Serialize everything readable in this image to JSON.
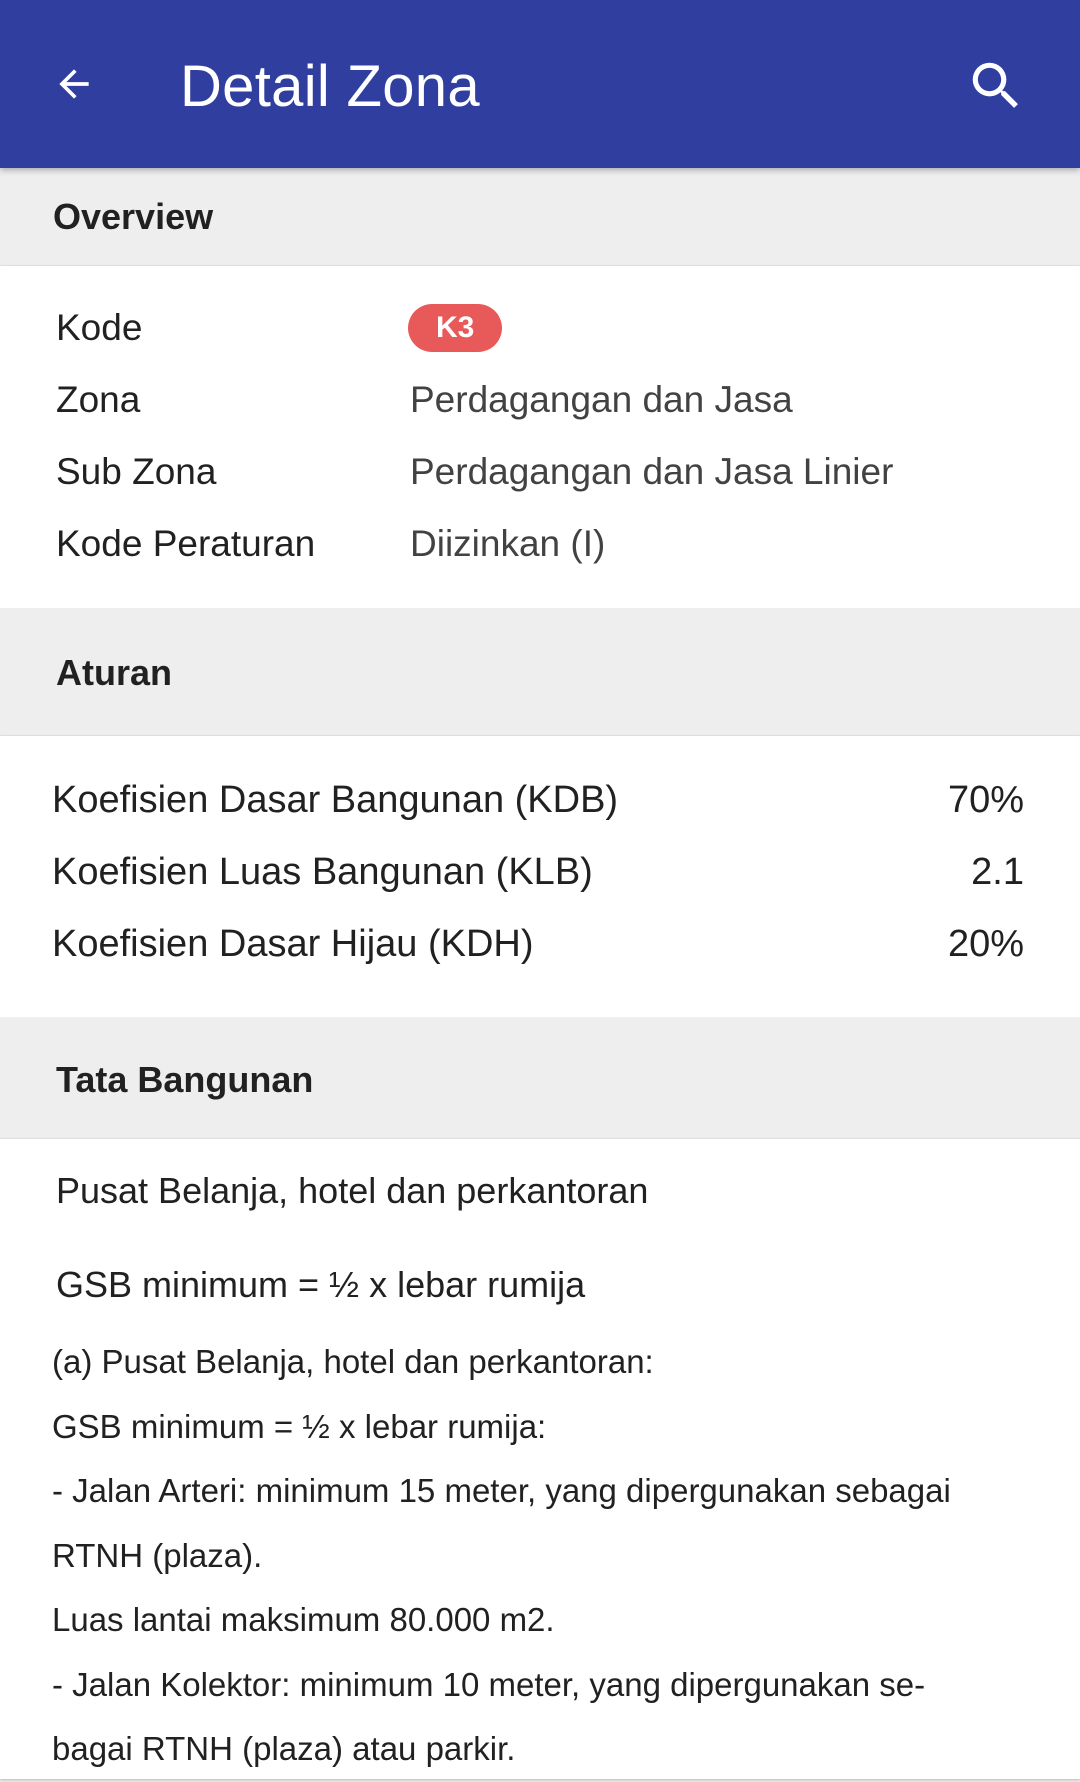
{
  "appbar": {
    "title": "Detail Zona",
    "back_icon": "arrow-back-icon",
    "search_icon": "search-icon",
    "color": "#303f9f"
  },
  "overview": {
    "title": "Overview",
    "rows": [
      {
        "label": "Kode",
        "value": "K3"
      },
      {
        "label": "Zona",
        "value": "Perdagangan dan Jasa"
      },
      {
        "label": "Sub Zona",
        "value": "Perdagangan dan Jasa Linier"
      },
      {
        "label": "Kode Peraturan",
        "value": "Diizinkan (I)"
      }
    ],
    "badge_color": "#e85a5a"
  },
  "aturan": {
    "title": "Aturan",
    "rows": [
      {
        "label": "Koefisien Dasar Bangunan (KDB)",
        "value": "70%"
      },
      {
        "label": "Koefisien Luas Bangunan (KLB)",
        "value": "2.1"
      },
      {
        "label": "Koefisien Dasar Hijau (KDH)",
        "value": "20%"
      }
    ]
  },
  "tata_bangunan": {
    "title": "Tata Bangunan",
    "subtitle": "Pusat Belanja, hotel dan perkantoran",
    "gsb_heading": "GSB minimum = ½ x lebar rumija",
    "lines": [
      "(a) Pusat Belanja, hotel dan perkantoran:",
      "GSB minimum = ½ x lebar rumija:",
      "- Jalan Arteri: minimum 15 meter, yang dipergunakan sebagai",
      "RTNH (plaza).",
      "Luas lantai maksimum 80.000 m2.",
      "- Jalan Kolektor: minimum 10 meter, yang dipergunakan se-",
      "bagai RTNH (plaza) atau parkir."
    ]
  }
}
